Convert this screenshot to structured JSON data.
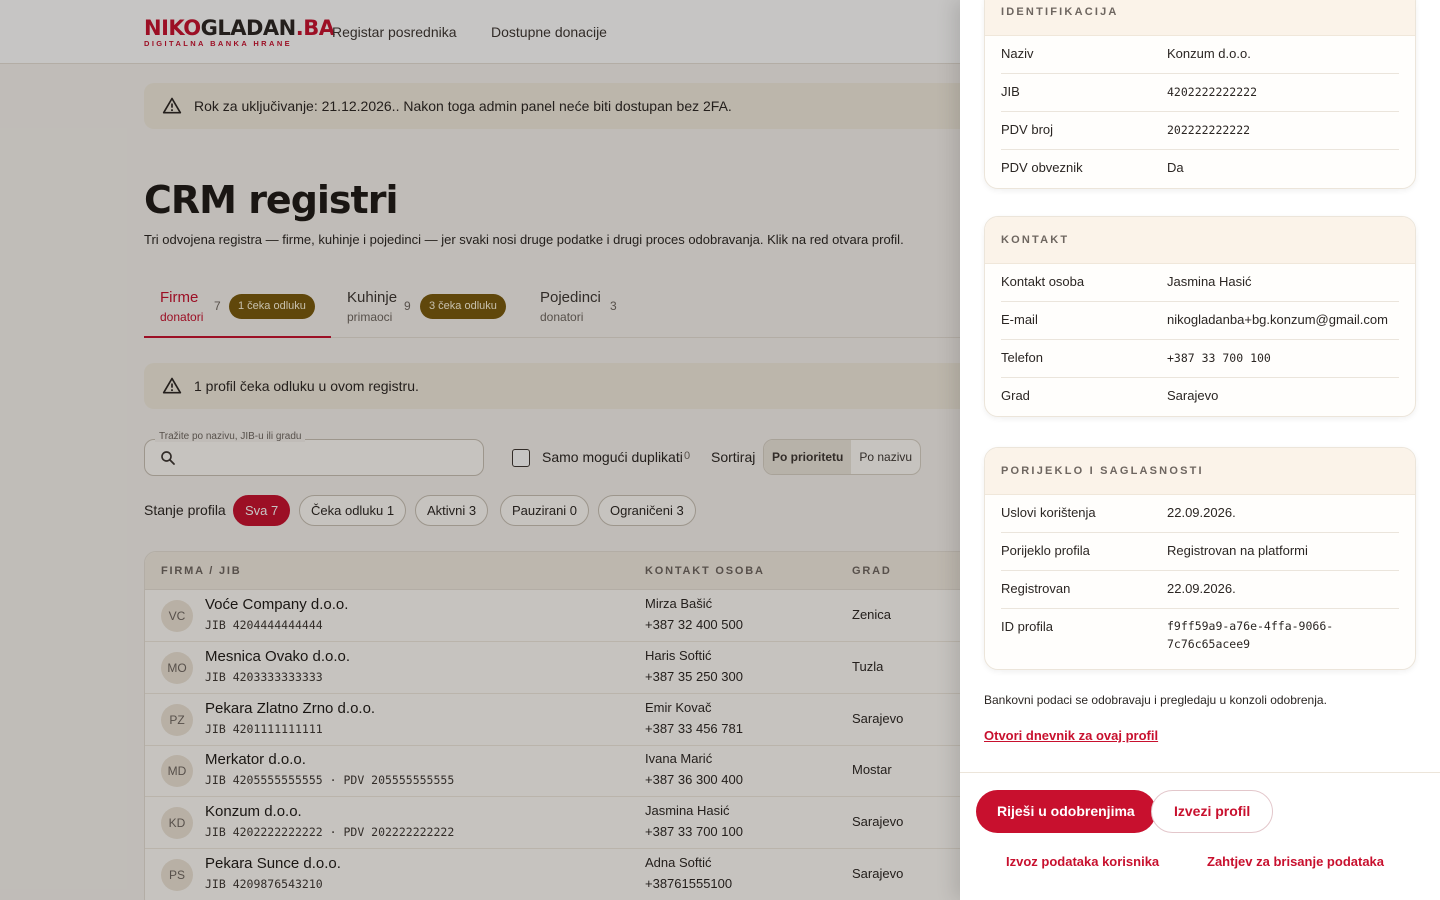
{
  "brand": {
    "logo_red": "NIKO",
    "logo_dark": "GLADAN",
    "logo_suffix": ".BA",
    "tagline": "DIGITALNA BANKA HRANE",
    "accent": "#c8102e",
    "badge_color": "#7a5a0c"
  },
  "nav": [
    {
      "label": "Registar posrednika"
    },
    {
      "label": "Dostupne donacije"
    }
  ],
  "alerts": {
    "twofa": "Rok za uključivanje: 21.12.2026.. Nakon toga admin panel neće biti dostupan bez 2FA.",
    "pending": "1 profil čeka odluku u ovom registru."
  },
  "page": {
    "title": "CRM registri",
    "subtitle": "Tri odvojena registra — firme, kuhinje i pojedinci — jer svaki nosi druge podatke i drugi proces odobravanja. Klik na red otvara profil."
  },
  "tabs": [
    {
      "label": "Firme",
      "sub": "donatori",
      "count": "7",
      "badge": "1 čeka odluku",
      "active": true
    },
    {
      "label": "Kuhinje",
      "sub": "primaoci",
      "count": "9",
      "badge": "3 čeka odluku",
      "active": false
    },
    {
      "label": "Pojedinci",
      "sub": "donatori",
      "count": "3",
      "badge": "",
      "active": false
    }
  ],
  "filters": {
    "search_label": "Tražite po nazivu, JIB-u ili gradu",
    "search_value": "",
    "duplicates_label": "Samo mogući duplikati",
    "duplicates_count": "0",
    "duplicates_checked": false,
    "sort_label": "Sortiraj",
    "sort_options": [
      "Po prioritetu",
      "Po nazivu"
    ],
    "sort_selected": "Po prioritetu",
    "state_label": "Stanje profila",
    "state_chips": [
      "Sva 7",
      "Čeka odluku 1",
      "Aktivni 3",
      "Pauzirani 0",
      "Ograničeni 3"
    ],
    "state_selected": "Sva 7"
  },
  "table": {
    "headers": [
      "FIRMA / JIB",
      "KONTAKT OSOBA",
      "GRAD"
    ],
    "rows": [
      {
        "initials": "VC",
        "name": "Voće Company d.o.o.",
        "jib": "JIB 4204444444444",
        "contact": "Mirza Bašić",
        "phone": "+387 32 400 500",
        "city": "Zenica"
      },
      {
        "initials": "MO",
        "name": "Mesnica Ovako d.o.o.",
        "jib": "JIB 4203333333333",
        "contact": "Haris Softić",
        "phone": "+387 35 250 300",
        "city": "Tuzla"
      },
      {
        "initials": "PZ",
        "name": "Pekara Zlatno Zrno d.o.o.",
        "jib": "JIB 4201111111111",
        "contact": "Emir Kovač",
        "phone": "+387 33 456 781",
        "city": "Sarajevo"
      },
      {
        "initials": "MD",
        "name": "Merkator d.o.o.",
        "jib": "JIB 4205555555555 · PDV 205555555555",
        "contact": "Ivana Marić",
        "phone": "+387 36 300 400",
        "city": "Mostar"
      },
      {
        "initials": "KD",
        "name": "Konzum d.o.o.",
        "jib": "JIB 4202222222222 · PDV 202222222222",
        "contact": "Jasmina Hasić",
        "phone": "+387 33 700 100",
        "city": "Sarajevo"
      },
      {
        "initials": "PS",
        "name": "Pekara Sunce d.o.o.",
        "jib": "JIB 4209876543210",
        "contact": "Adna Softić",
        "phone": "+38761555100",
        "city": "Sarajevo"
      }
    ]
  },
  "drawer": {
    "sections": {
      "identifikacija": {
        "title": "IDENTIFIKACIJA",
        "fields": [
          {
            "k": "Naziv",
            "v": "Konzum d.o.o."
          },
          {
            "k": "JIB",
            "v": "4202222222222"
          },
          {
            "k": "PDV broj",
            "v": "202222222222"
          },
          {
            "k": "PDV obveznik",
            "v": "Da"
          }
        ]
      },
      "kontakt": {
        "title": "KONTAKT",
        "fields": [
          {
            "k": "Kontakt osoba",
            "v": "Jasmina Hasić"
          },
          {
            "k": "E-mail",
            "v": "nikogladanba+bg.konzum@gmail.com"
          },
          {
            "k": "Telefon",
            "v": "+387 33 700 100"
          },
          {
            "k": "Grad",
            "v": "Sarajevo"
          }
        ]
      },
      "porijeklo": {
        "title": "PORIJEKLO I SAGLASNOSTI",
        "fields": [
          {
            "k": "Uslovi korištenja",
            "v": "22.09.2026."
          },
          {
            "k": "Porijeklo profila",
            "v": "Registrovan na platformi"
          },
          {
            "k": "Registrovan",
            "v": "22.09.2026."
          },
          {
            "k": "ID profila",
            "v": "f9ff59a9-a76e-4ffa-9066-7c76c65acee9"
          }
        ]
      }
    },
    "bank_note": "Bankovni podaci se odobravaju i pregledaju u konzoli odobrenja.",
    "log_link": "Otvori dnevnik za ovaj profil",
    "actions": {
      "primary": "Riješi u odobrenjima",
      "export_profile": "Izvezi profil",
      "export_user_data": "Izvoz podataka korisnika",
      "delete_request": "Zahtjev za brisanje podataka"
    }
  }
}
